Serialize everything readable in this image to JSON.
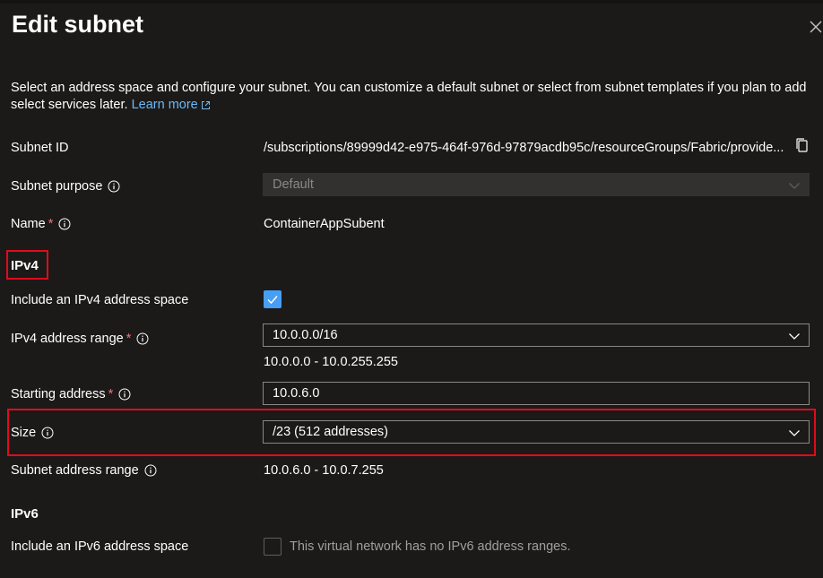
{
  "panel": {
    "title": "Edit subnet",
    "intro": "Select an address space and configure your subnet. You can customize a default subnet or select from subnet templates if you plan to add select services later.",
    "learn_more": "Learn more"
  },
  "fields": {
    "subnet_id": {
      "label": "Subnet ID",
      "value": "/subscriptions/89999d42-e975-464f-976d-97879acdb95c/resourceGroups/Fabric/provide..."
    },
    "subnet_purpose": {
      "label": "Subnet purpose",
      "value": "Default"
    },
    "name": {
      "label": "Name",
      "required": "*",
      "value": "ContainerAppSubent"
    }
  },
  "ipv4": {
    "heading": "IPv4",
    "include_label": "Include an IPv4 address space",
    "include_checked": true,
    "range_label": "IPv4 address range",
    "range_required": "*",
    "range_value": "10.0.0.0/16",
    "range_hint": "10.0.0.0 - 10.0.255.255",
    "start_label": "Starting address",
    "start_required": "*",
    "start_value": "10.0.6.0",
    "size_label": "Size",
    "size_value": "/23 (512 addresses)",
    "subnet_range_label": "Subnet address range",
    "subnet_range_value": "10.0.6.0 - 10.0.7.255"
  },
  "ipv6": {
    "heading": "IPv6",
    "include_label": "Include an IPv6 address space",
    "include_checked": false,
    "note": "This virtual network has no IPv6 address ranges."
  },
  "colors": {
    "background": "#1b1a19",
    "link": "#6cb8f6",
    "accent": "#479ef5",
    "required": "#f1707b",
    "highlight": "#e00b1c"
  },
  "icons": [
    "close-icon",
    "external-link-icon",
    "copy-icon",
    "info-icon",
    "chevron-down-icon",
    "checkmark-icon"
  ]
}
